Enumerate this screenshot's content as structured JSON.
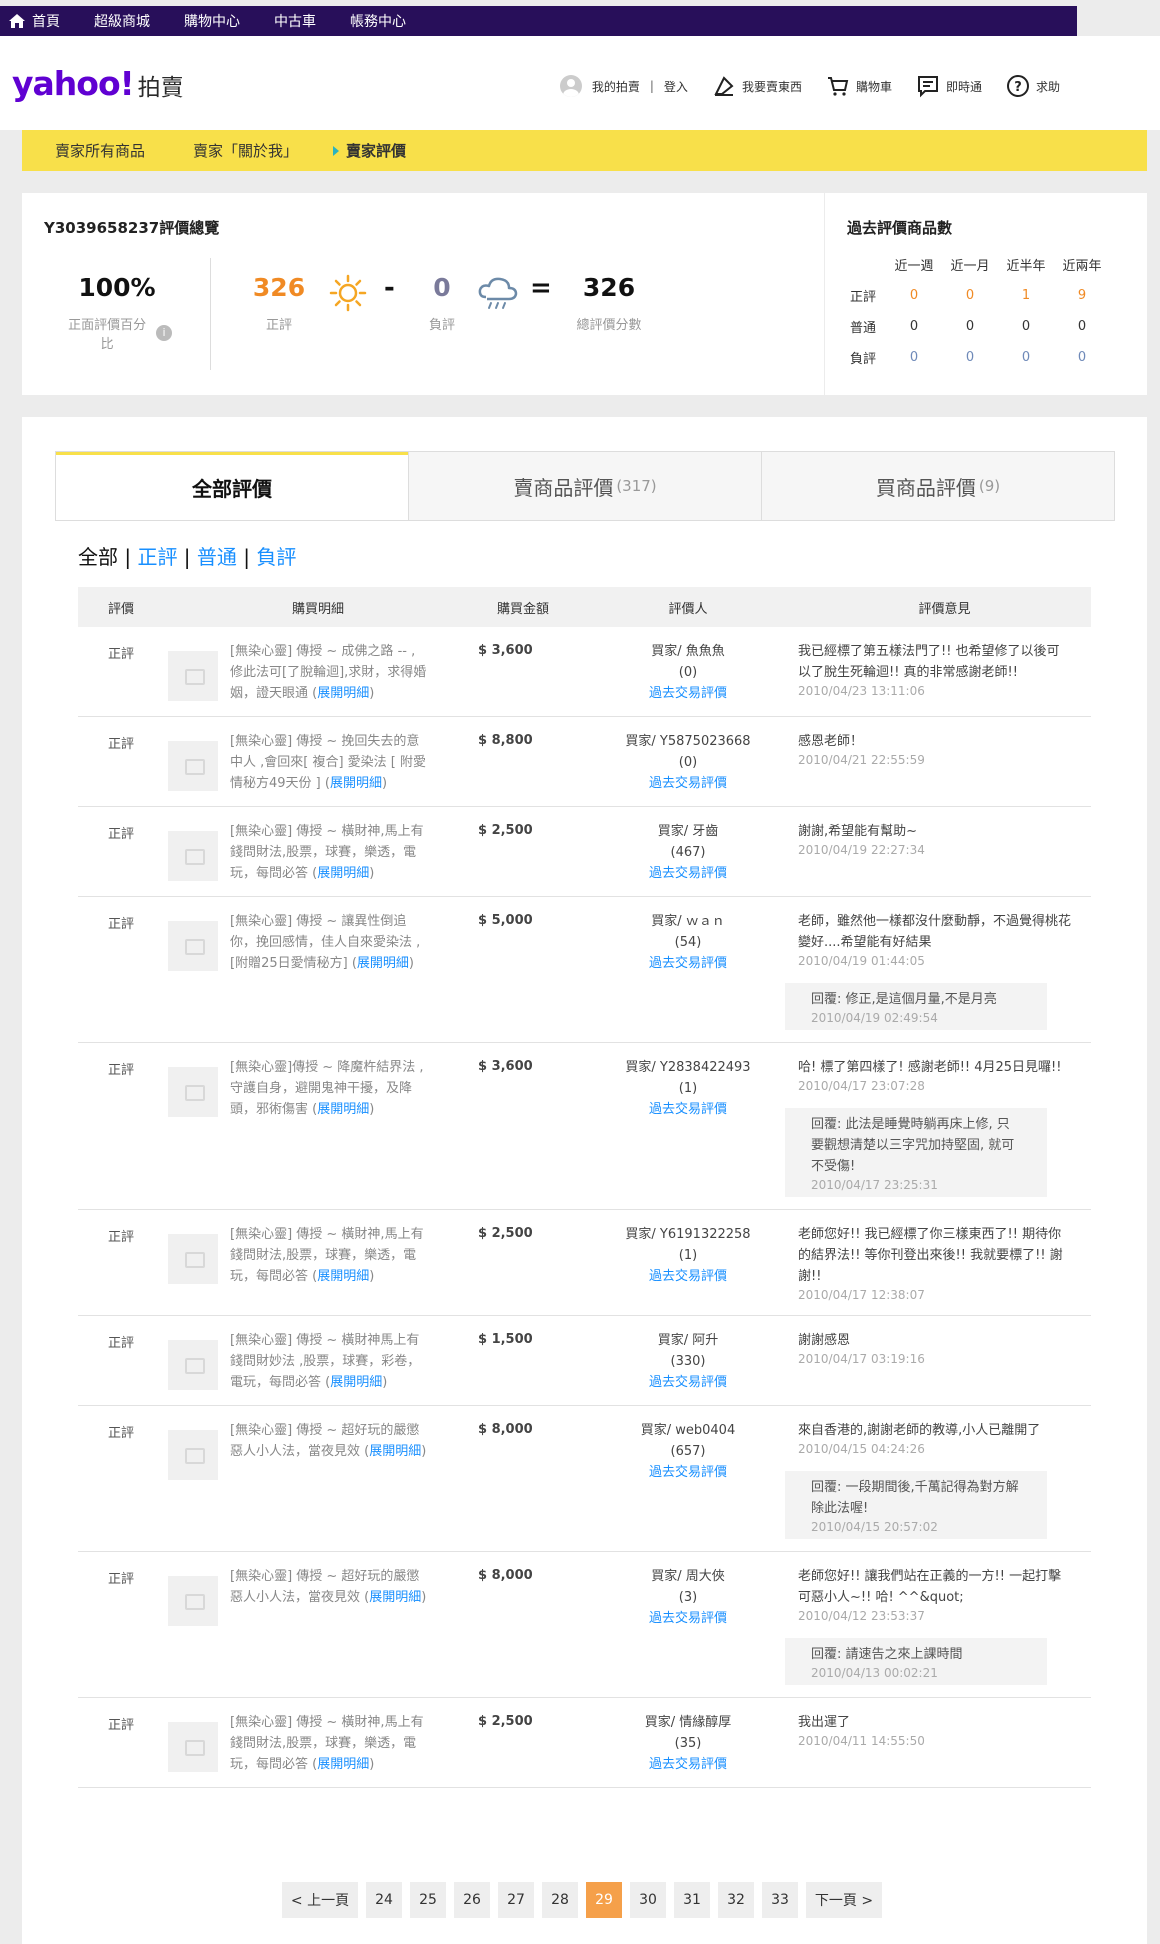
{
  "topnav": [
    {
      "label": "首頁",
      "icon": "home-icon"
    },
    {
      "label": "超級商城"
    },
    {
      "label": "購物中心"
    },
    {
      "label": "中古車"
    },
    {
      "label": "帳務中心"
    }
  ],
  "header": {
    "logo": "yahoo!",
    "logo_sub": "拍賣",
    "my_auction": "我的拍賣",
    "login": "登入",
    "sell": "我要賣東西",
    "cart": "購物車",
    "messenger": "即時通",
    "help": "求助"
  },
  "ybar": {
    "all_items": "賣家所有商品",
    "about": "賣家「關於我」",
    "rating": "賣家評價"
  },
  "summary": {
    "title": "Y3039658237評價總覽",
    "pct_value": "100%",
    "pct_label": "正面評價百分比",
    "pos_value": "326",
    "pos_label": "正評",
    "minus": "-",
    "neg_value": "0",
    "neg_label": "負評",
    "equals": "=",
    "total_value": "326",
    "total_label": "總評價分數"
  },
  "past": {
    "title": "過去評價商品數",
    "cols": [
      "近一週",
      "近一月",
      "近半年",
      "近兩年"
    ],
    "rows": [
      {
        "label": "正評",
        "values": [
          "0",
          "0",
          "1",
          "9"
        ]
      },
      {
        "label": "普通",
        "values": [
          "0",
          "0",
          "0",
          "0"
        ]
      },
      {
        "label": "負評",
        "values": [
          "0",
          "0",
          "0",
          "0"
        ]
      }
    ]
  },
  "tabs": {
    "all": "全部評價",
    "sell": "賣商品評價",
    "sell_count": "(317)",
    "buy": "買商品評價",
    "buy_count": "(9)"
  },
  "filters": {
    "all": "全部",
    "pos": "正評",
    "normal": "普通",
    "neg": "負評"
  },
  "thead": {
    "c1": "評價",
    "c2": "購買明細",
    "c3": "購買金額",
    "c4": "評價人",
    "c5": "評價意見"
  },
  "rows": [
    {
      "rating": "正評",
      "desc": "[無染心靈] 傳授 ~ 成佛之路 -- , 修此法可[了脫輪迴],求財，求得婚姻，證天眼通 (",
      "expand": "展開明細",
      "tail": ")",
      "amount": "$ 3,600",
      "rater": "買家/ 魚魚魚",
      "score": "(0)",
      "history": "過去交易評價",
      "comment": "我已經標了第五樣法門了!! 也希望修了以後可以了脫生死輪迴!! 真的非常感謝老師!!",
      "date": "2010/04/23 13:11:06"
    },
    {
      "rating": "正評",
      "desc": "[無染心靈] 傳授 ~ 挽回失去的意中人 ,會回來[ 複合] 愛染法 [ 附愛情秘方49天份 ] (",
      "expand": "展開明細",
      "tail": ")",
      "amount": "$ 8,800",
      "rater": "買家/ Y5875023668",
      "score": "(0)",
      "history": "過去交易評價",
      "comment": "感恩老師！",
      "date": "2010/04/21 22:55:59"
    },
    {
      "rating": "正評",
      "desc": "[無染心靈] 傳授 ~ 橫財神,馬上有錢問財法,股票，球賽，樂透，電玩，每問必答 (",
      "expand": "展開明細",
      "tail": ")",
      "amount": "$ 2,500",
      "rater": "買家/ 牙齒",
      "score": "(467)",
      "history": "過去交易評價",
      "comment": "謝謝,希望能有幫助~",
      "date": "2010/04/19 22:27:34"
    },
    {
      "rating": "正評",
      "desc": "[無染心靈] 傳授 ~ 讓異性倒追你，挽回感情，佳人自來愛染法 , [附贈25日愛情秘方] (",
      "expand": "展開明細",
      "tail": ")",
      "amount": "$ 5,000",
      "rater": "買家/ ｗａｎ",
      "score": "(54)",
      "history": "過去交易評價",
      "comment": "老師，雖然他一樣都沒什麼動靜，不過覺得桃花變好....希望能有好結果",
      "date": "2010/04/19 01:44:05",
      "reply": "回覆: 修正,是這個月量,不是月亮",
      "reply_date": "2010/04/19 02:49:54"
    },
    {
      "rating": "正評",
      "desc": "[無染心靈]傳授 ~ 降魔杵結界法 , 守護自身，避開鬼神干擾，及降頭，邪術傷害 (",
      "expand": "展開明細",
      "tail": ")",
      "amount": "$ 3,600",
      "rater": "買家/ Y2838422493",
      "score": "(1)",
      "history": "過去交易評價",
      "comment": "哈! 標了第四樣了! 感謝老師!! 4月25日見囉!!",
      "date": "2010/04/17 23:07:28",
      "reply": "回覆: 此法是睡覺時躺再床上修, 只要觀想清楚以三字咒加持堅固, 就可不受傷!",
      "reply_date": "2010/04/17 23:25:31"
    },
    {
      "rating": "正評",
      "desc": "[無染心靈] 傳授 ~ 橫財神,馬上有錢問財法,股票，球賽，樂透，電玩，每問必答 (",
      "expand": "展開明細",
      "tail": ")",
      "amount": "$ 2,500",
      "rater": "買家/ Y6191322258",
      "score": "(1)",
      "history": "過去交易評價",
      "comment": "老師您好!! 我已經標了你三樣東西了!! 期待你的結界法!! 等你刊登出來後!! 我就要標了!! 謝謝!!",
      "date": "2010/04/17 12:38:07"
    },
    {
      "rating": "正評",
      "desc": "[無染心靈] 傳授 ~ 橫財神馬上有錢問財妙法 ,股票，球賽，彩卷，電玩，每問必答 (",
      "expand": "展開明細",
      "tail": ")",
      "amount": "$ 1,500",
      "rater": "買家/ 阿升",
      "score": "(330)",
      "history": "過去交易評價",
      "comment": "謝謝感恩",
      "date": "2010/04/17 03:19:16"
    },
    {
      "rating": "正評",
      "desc": "[無染心靈] 傳授 ~ 超好玩的嚴懲惡人小人法，當夜見效 (",
      "expand": "展開明細",
      "tail": ")",
      "amount": "$ 8,000",
      "rater": "買家/ web0404",
      "score": "(657)",
      "history": "過去交易評價",
      "comment": "來自香港的,謝謝老師的教導,小人已離開了",
      "date": "2010/04/15 04:24:26",
      "reply": "回覆: 一段期間後,千萬記得為對方解除此法喔!",
      "reply_date": "2010/04/15 20:57:02"
    },
    {
      "rating": "正評",
      "desc": "[無染心靈] 傳授 ~ 超好玩的嚴懲惡人小人法，當夜見效 (",
      "expand": "展開明細",
      "tail": ")",
      "amount": "$ 8,000",
      "rater": "買家/ 周大俠",
      "score": "(3)",
      "history": "過去交易評價",
      "comment": "老師您好!! 讓我們站在正義的一方!! 一起打擊可惡小人~!! 哈! ^^&quot;",
      "date": "2010/04/12 23:53:37",
      "reply": "回覆: 請速告之來上課時間",
      "reply_date": "2010/04/13 00:02:21"
    },
    {
      "rating": "正評",
      "desc": "[無染心靈] 傳授 ~ 橫財神,馬上有錢問財法,股票，球賽，樂透，電玩，每問必答 (",
      "expand": "展開明細",
      "tail": ")",
      "amount": "$ 2,500",
      "rater": "買家/ 情緣醇厚",
      "score": "(35)",
      "history": "過去交易評價",
      "comment": "我出運了",
      "date": "2010/04/11 14:55:50"
    }
  ],
  "pager": {
    "prev": "< 上一頁",
    "pages": [
      "24",
      "25",
      "26",
      "27",
      "28",
      "29",
      "30",
      "31",
      "32",
      "33"
    ],
    "current": "29",
    "next": "下一頁 >"
  },
  "colors": {
    "topnav": "#280f5a",
    "brand": "#6001d2",
    "yellow": "#f8e04a",
    "orange": "#f08a24",
    "link": "#188fff"
  }
}
